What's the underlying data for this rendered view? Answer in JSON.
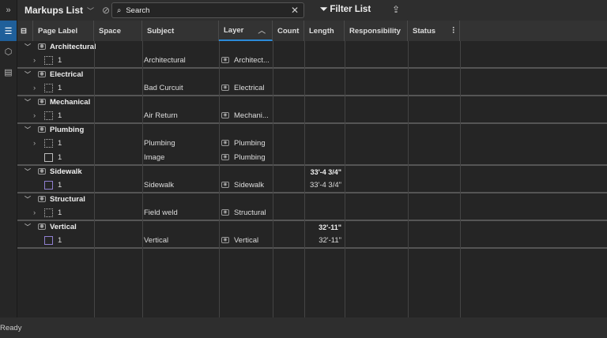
{
  "toolbar": {
    "title": "Markups List",
    "search_placeholder": "Search",
    "filter_label": "Filter List"
  },
  "columns": [
    "Page Label",
    "Space",
    "Subject",
    "Layer",
    "Count",
    "Length",
    "Responsibility",
    "Status"
  ],
  "groups": [
    {
      "name": "Architectural",
      "length": "",
      "items": [
        {
          "icon": "rect",
          "label": "1",
          "expand": true,
          "subject": "Architectural",
          "layer": "Architect...",
          "length": ""
        }
      ]
    },
    {
      "name": "Electrical",
      "length": "",
      "items": [
        {
          "icon": "rect",
          "label": "1",
          "expand": true,
          "subject": "Bad Curcuit",
          "layer": "Electrical",
          "length": ""
        }
      ]
    },
    {
      "name": "Mechanical",
      "length": "",
      "items": [
        {
          "icon": "rect",
          "label": "1",
          "expand": true,
          "subject": "Air Return",
          "layer": "Mechani...",
          "length": ""
        }
      ]
    },
    {
      "name": "Plumbing",
      "length": "",
      "items": [
        {
          "icon": "rect",
          "label": "1",
          "expand": true,
          "subject": "Plumbing",
          "layer": "Plumbing",
          "length": ""
        },
        {
          "icon": "img",
          "label": "1",
          "expand": false,
          "subject": "Image",
          "layer": "Plumbing",
          "length": ""
        }
      ]
    },
    {
      "name": "Sidewalk",
      "length": "33'-4 3/4\"",
      "items": [
        {
          "icon": "poly",
          "label": "1",
          "expand": false,
          "subject": "Sidewalk",
          "layer": "Sidewalk",
          "length": "33'-4 3/4\""
        }
      ]
    },
    {
      "name": "Structural",
      "length": "",
      "items": [
        {
          "icon": "rect",
          "label": "1",
          "expand": true,
          "subject": "Field weld",
          "layer": "Structural",
          "length": ""
        }
      ]
    },
    {
      "name": "Vertical",
      "length": "32'-11\"",
      "items": [
        {
          "icon": "poly",
          "label": "1",
          "expand": false,
          "subject": "Vertical",
          "layer": "Vertical",
          "length": "32'-11\""
        }
      ]
    }
  ],
  "status_bar": {
    "text": "Ready"
  }
}
